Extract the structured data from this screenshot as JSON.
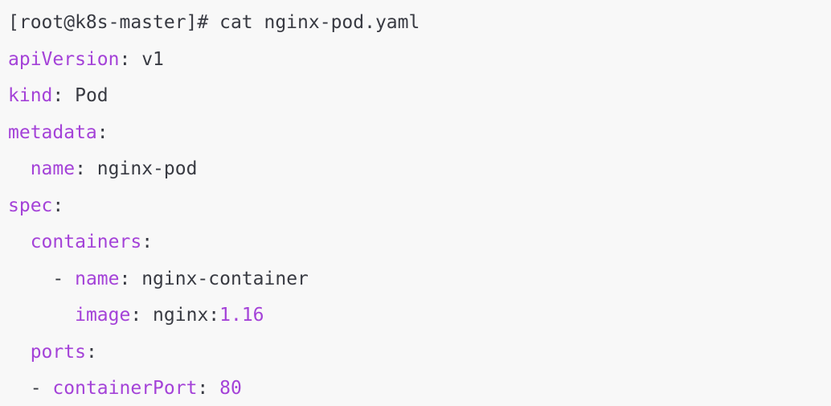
{
  "terminal": {
    "prompt": "[root@k8s-master]# cat nginx-pod.yaml",
    "lines": [
      {
        "indent": "",
        "dash": "",
        "key": "apiVersion",
        "sep": ":",
        "value": " v1",
        "num": ""
      },
      {
        "indent": "",
        "dash": "",
        "key": "kind",
        "sep": ":",
        "value": " Pod",
        "num": ""
      },
      {
        "indent": "",
        "dash": "",
        "key": "metadata",
        "sep": ":",
        "value": "",
        "num": ""
      },
      {
        "indent": "  ",
        "dash": "",
        "key": "name",
        "sep": ":",
        "value": " nginx-pod",
        "num": ""
      },
      {
        "indent": "",
        "dash": "",
        "key": "spec",
        "sep": ":",
        "value": "",
        "num": ""
      },
      {
        "indent": "  ",
        "dash": "",
        "key": "containers",
        "sep": ":",
        "value": "",
        "num": ""
      },
      {
        "indent": "    ",
        "dash": "- ",
        "key": "name",
        "sep": ":",
        "value": " nginx-container",
        "num": ""
      },
      {
        "indent": "      ",
        "dash": "",
        "key": "image",
        "sep": ":",
        "value": " nginx:",
        "num": "1.16"
      },
      {
        "indent": "  ",
        "dash": "",
        "key": "ports",
        "sep": ":",
        "value": "",
        "num": ""
      },
      {
        "indent": "  ",
        "dash": "- ",
        "key": "containerPort",
        "sep": ":",
        "value": " ",
        "num": "80"
      }
    ]
  },
  "colors": {
    "background": "#f8f8f8",
    "key": "#a442d8",
    "text": "#383a42"
  }
}
